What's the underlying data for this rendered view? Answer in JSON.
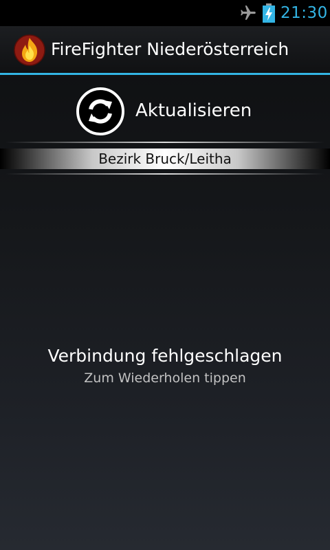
{
  "status_bar": {
    "time": "21:30",
    "accent_color": "#33b5e5",
    "icons": [
      "airplane-mode-icon",
      "battery-charging-icon"
    ]
  },
  "action_bar": {
    "app_title": "FireFighter Niederösterreich",
    "app_icon": "fire-icon",
    "accent_color": "#33b5e5"
  },
  "refresh": {
    "label": "Aktualisieren",
    "icon": "refresh-icon"
  },
  "district": {
    "label": "Bezirk Bruck/Leitha"
  },
  "message": {
    "title": "Verbindung fehlgeschlagen",
    "subtitle": "Zum Wiederholen tippen"
  }
}
